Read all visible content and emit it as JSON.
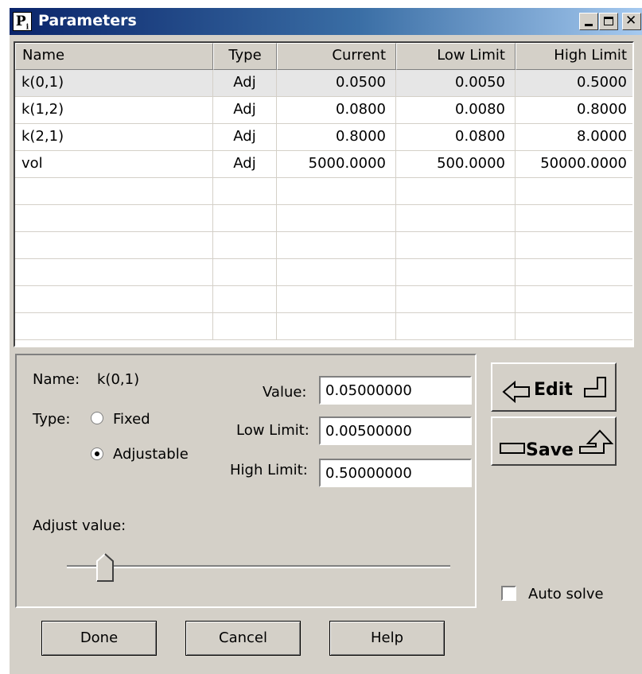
{
  "window": {
    "title": "Parameters",
    "icon_letter": "P",
    "icon_sub": "i"
  },
  "table": {
    "headers": [
      "Name",
      "Type",
      "Current",
      "Low Limit",
      "High Limit"
    ],
    "rows": [
      [
        "k(0,1)",
        "Adj",
        "0.0500",
        "0.0050",
        "0.5000"
      ],
      [
        "k(1,2)",
        "Adj",
        "0.0800",
        "0.0080",
        "0.8000"
      ],
      [
        "k(2,1)",
        "Adj",
        "0.8000",
        "0.0800",
        "8.0000"
      ],
      [
        "vol",
        "Adj",
        "5000.0000",
        "500.0000",
        "50000.0000"
      ]
    ],
    "selected_row": 0
  },
  "details": {
    "name_label": "Name:",
    "name_value": "k(0,1)",
    "type_label": "Type:",
    "type_options": [
      "Fixed",
      "Adjustable"
    ],
    "type_selected": "Adjustable",
    "value_label": "Value:",
    "value": "0.05000000",
    "low_label": "Low Limit:",
    "low": "0.00500000",
    "high_label": "High Limit:",
    "high": "0.50000000",
    "adjust_label": "Adjust value:",
    "slider_fraction": 0.1
  },
  "side": {
    "edit_label": "Edit",
    "save_label": "Save",
    "auto_solve_label": "Auto solve",
    "auto_solve_checked": false
  },
  "buttons": {
    "done": "Done",
    "cancel": "Cancel",
    "help": "Help"
  }
}
